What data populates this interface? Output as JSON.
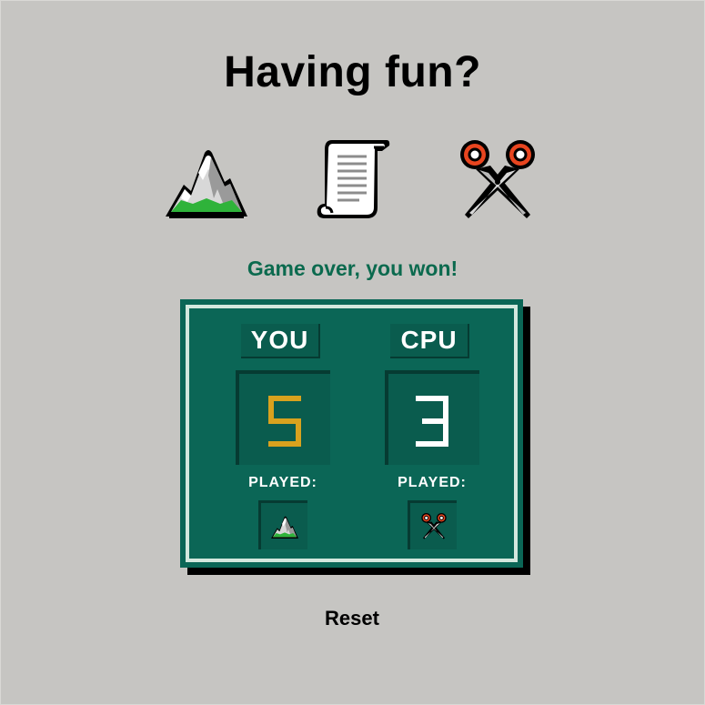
{
  "title": "Having fun?",
  "choices": [
    {
      "id": "rock",
      "icon": "mountain-icon"
    },
    {
      "id": "paper",
      "icon": "scroll-icon"
    },
    {
      "id": "scissors",
      "icon": "scissors-icon"
    }
  ],
  "status_message": "Game over, you won!",
  "scoreboard": {
    "you": {
      "label": "YOU",
      "score": "5",
      "score_color": "#d9a21e",
      "played_label": "PLAYED:",
      "played_icon": "mountain-icon"
    },
    "cpu": {
      "label": "CPU",
      "score": "3",
      "score_color": "#ffffff",
      "played_label": "PLAYED:",
      "played_icon": "scissors-icon"
    }
  },
  "reset_label": "Reset",
  "colors": {
    "background": "#c6c5c2",
    "board": "#0b6656",
    "board_border": "#d4e8de",
    "status": "#0b6a4e",
    "accent_red": "#e8451f"
  }
}
